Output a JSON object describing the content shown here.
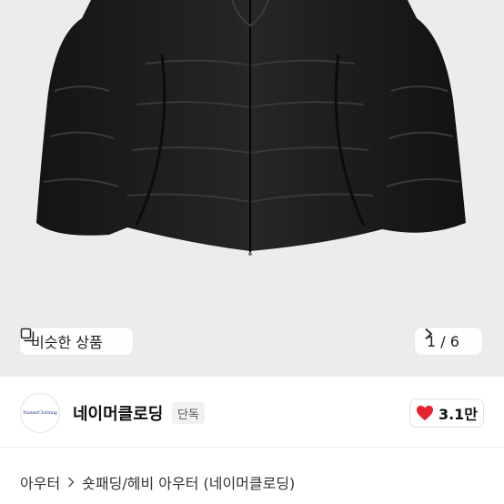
{
  "hero": {
    "image_alt": "black puffer jacket",
    "similar_label": "비슷한 상품",
    "similar_icon": "similar-items-icon",
    "pager": {
      "text": "1 / 6",
      "icon": "chevron-right-icon"
    }
  },
  "brand": {
    "logo_text": "NamerClothing",
    "name": "네이머클로딩",
    "badge": "단독",
    "likes": "3.1만",
    "heart_color": "#e8222e"
  },
  "breadcrumb": {
    "items": [
      "아우터",
      "숏패딩/헤비 아우터 (네이머클로딩)"
    ],
    "separator_icon": "chevron-right-icon"
  }
}
